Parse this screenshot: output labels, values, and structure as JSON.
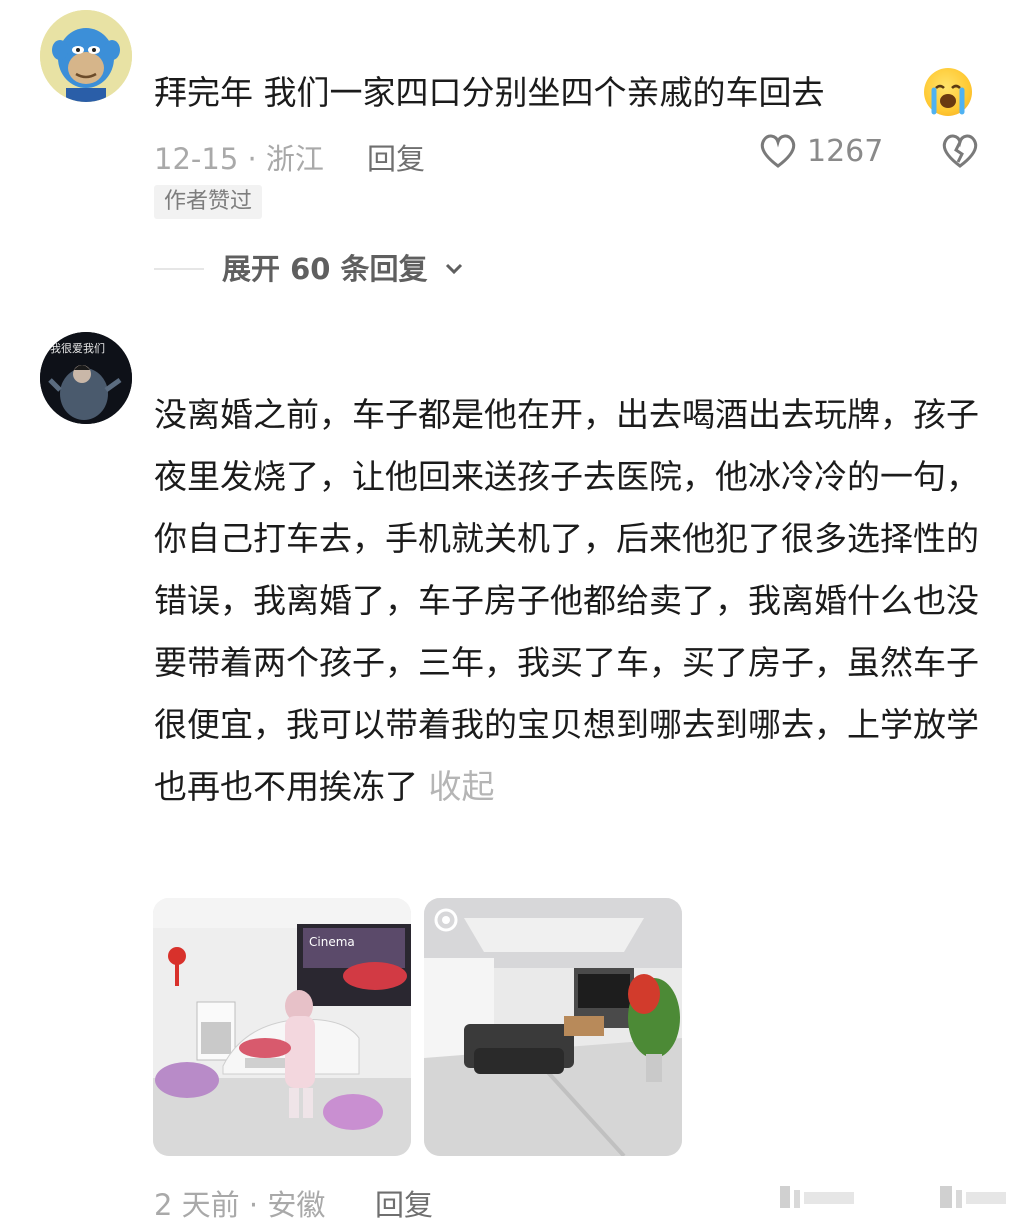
{
  "comments": [
    {
      "text": "拜完年 我们一家四口分别坐四个亲戚的车回去",
      "emoji_icon": "loudly-crying-face-icon",
      "date_location": "12-15 · 浙江",
      "reply_label": "回复",
      "like_count": "1267",
      "author_badge": "作者赞过",
      "expand_label": "展开 60 条回复",
      "avatar_icon": "cartoon-ape-avatar"
    },
    {
      "text": "没离婚之前，车子都是他在开，出去喝酒出去玩牌，孩子夜里发烧了，让他回来送孩子去医院，他冰冷冷的一句，你自己打车去，手机就关机了，后来他犯了很多选择性的错误，我离婚了，车子房子他都给卖了，我离婚什么也没要带着两个孩子，三年，我买了车，买了房子，虽然车子很便宜，我可以带着我的宝贝想到哪去到哪去，上学放学也再也不用挨冻了",
      "collapse_label": "收起",
      "date_location": "2 天前 · 安徽",
      "reply_label": "回复",
      "avatar_text": "我很爱我们",
      "avatar_icon": "person-photo-avatar",
      "photos": [
        {
          "name": "car-dealership-photo",
          "banner_text": "Cinema"
        },
        {
          "name": "living-room-photo"
        }
      ]
    }
  ]
}
